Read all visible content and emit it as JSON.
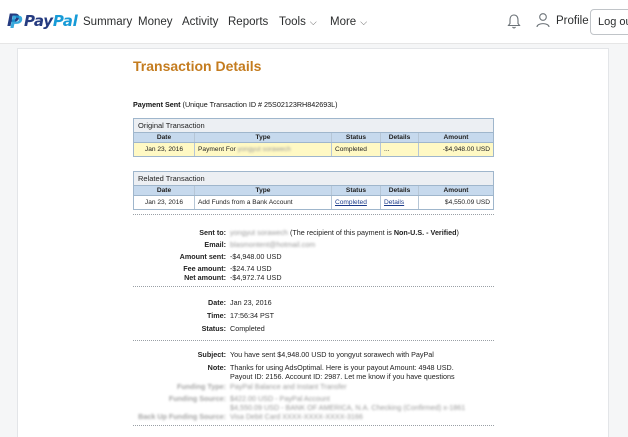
{
  "nav": {
    "logo_pay": "Pay",
    "logo_pal": "Pal",
    "items": [
      "Summary",
      "Money",
      "Activity",
      "Reports",
      "Tools",
      "More"
    ],
    "caret": "⌵",
    "profile": "Profile",
    "logout": "Log out"
  },
  "page": {
    "title": "Transaction Details",
    "payment_type": "Payment Sent",
    "unique_id_text": "(Unique Transaction ID # 25S02123RH842693L)"
  },
  "original_transaction": {
    "caption": "Original Transaction",
    "headers": [
      "Date",
      "Type",
      "Status",
      "Details",
      "Amount"
    ],
    "row": {
      "date": "Jan 23, 2016",
      "type_prefix": "Payment For",
      "type_redacted": "yongyut sorawech",
      "status": "Completed",
      "details": "...",
      "amount": "-$4,948.00 USD"
    }
  },
  "related_transaction": {
    "caption": "Related Transaction",
    "headers": [
      "Date",
      "Type",
      "Status",
      "Details",
      "Amount"
    ],
    "row": {
      "date": "Jan 23, 2016",
      "type": "Add Funds from a Bank Account",
      "status": "Completed",
      "details": "Details",
      "amount": "$4,550.09 USD"
    }
  },
  "recipient": {
    "sent_to_label": "Sent to:",
    "sent_to_redacted": "yongyut sorawech",
    "sent_to_note_prefix": "(The recipient of this payment is",
    "sent_to_note_bold": "Non-U.S. - Verified",
    "sent_to_note_suffix": ")",
    "email_label": "Email:",
    "email_redacted": "blasmontent@hotmail.com",
    "amount_sent_label": "Amount sent:",
    "amount_sent": "-$4,948.00 USD",
    "fee_label": "Fee amount:",
    "fee": "-$24.74 USD",
    "net_label": "Net amount:",
    "net": "-$4,972.74 USD"
  },
  "datetime": {
    "date_label": "Date:",
    "date": "Jan 23, 2016",
    "time_label": "Time:",
    "time": "17:56:34 PST",
    "status_label": "Status:",
    "status": "Completed"
  },
  "message": {
    "subject_label": "Subject:",
    "subject": "You have sent $4,948.00 USD to yongyut sorawech with PayPal",
    "note_label": "Note:",
    "note_line1": "Thanks for using AdsOptimal. Here is your payout Amount: 4948 USD.",
    "note_line2": "Payout ID: 2156. Account ID: 2987. Let me know if you have questions",
    "funding_type_label": "Funding Type:",
    "funding_type": "PayPal Balance and Instant Transfer",
    "funding_source_label": "Funding Source:",
    "funding_source_1": "$422.00 USD - PayPal Account",
    "funding_source_2": "$4,550.09 USD - BANK OF AMERICA, N.A. Checking (Confirmed) x-1861",
    "backup_label": "Back Up Funding Source:",
    "backup": "Visa Debit Card XXXX-XXXX-XXXX-3166"
  },
  "colors": {
    "title": "#c47c1f",
    "table_header": "#c6d9ed",
    "highlight_row": "#fff9c4",
    "logo_dark": "#253b80",
    "logo_light": "#179bd7"
  }
}
